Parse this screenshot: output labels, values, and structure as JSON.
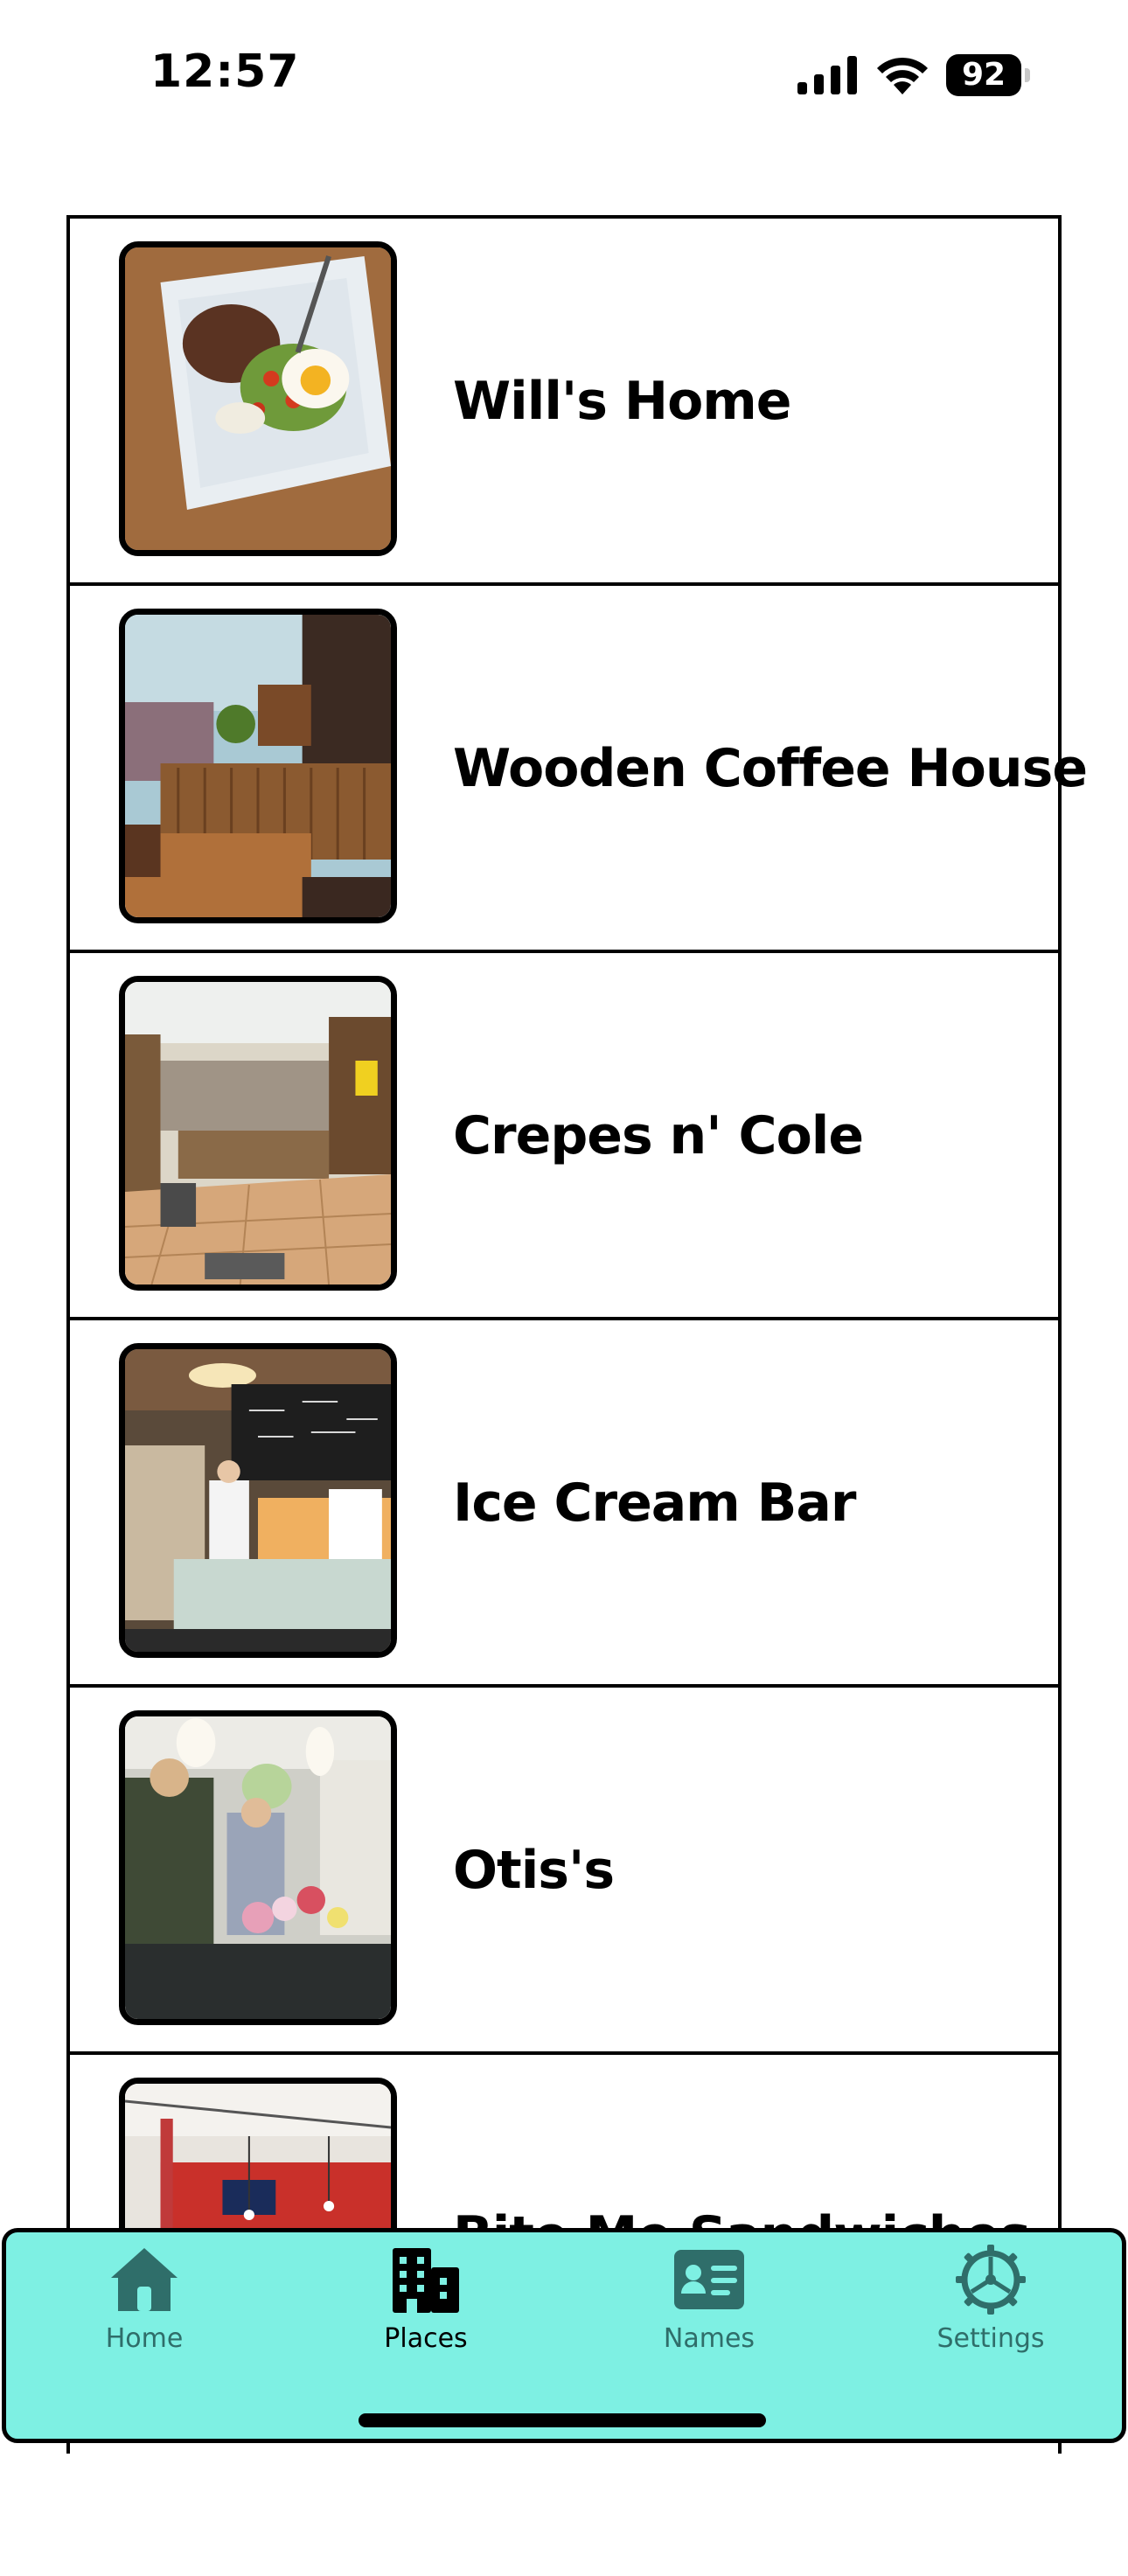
{
  "status_bar": {
    "time": "12:57",
    "battery": "92",
    "signal_icon": "cellular-signal-icon",
    "wifi_icon": "wifi-icon"
  },
  "places": [
    {
      "name": "Will's Home",
      "photo": "plate-of-steak-and-eggs-salad"
    },
    {
      "name": "Wooden Coffee House",
      "photo": "wooden-cafe-counter-interior"
    },
    {
      "name": "Crepes n' Cole",
      "photo": "cafe-interior-with-tiled-floor"
    },
    {
      "name": "Ice Cream Bar",
      "photo": "ice-cream-bar-counter-with-chalkboards"
    },
    {
      "name": "Otis's",
      "photo": "people-in-shop-with-flowers-and-lamps"
    },
    {
      "name": "Bite Me Sandwiches",
      "photo": "sandwich-shop-red-wall-interior"
    }
  ],
  "tab_bar": {
    "tabs": [
      {
        "label": "Home",
        "icon": "house-icon",
        "active": false
      },
      {
        "label": "Places",
        "icon": "buildings-icon",
        "active": true
      },
      {
        "label": "Names",
        "icon": "contact-card-icon",
        "active": false
      },
      {
        "label": "Settings",
        "icon": "gear-icon",
        "active": false
      }
    ]
  },
  "colors": {
    "tab_bar_background": "#7ef0e3",
    "tab_inactive": "#2f6e6a",
    "tab_active": "#000000",
    "border": "#000000"
  }
}
